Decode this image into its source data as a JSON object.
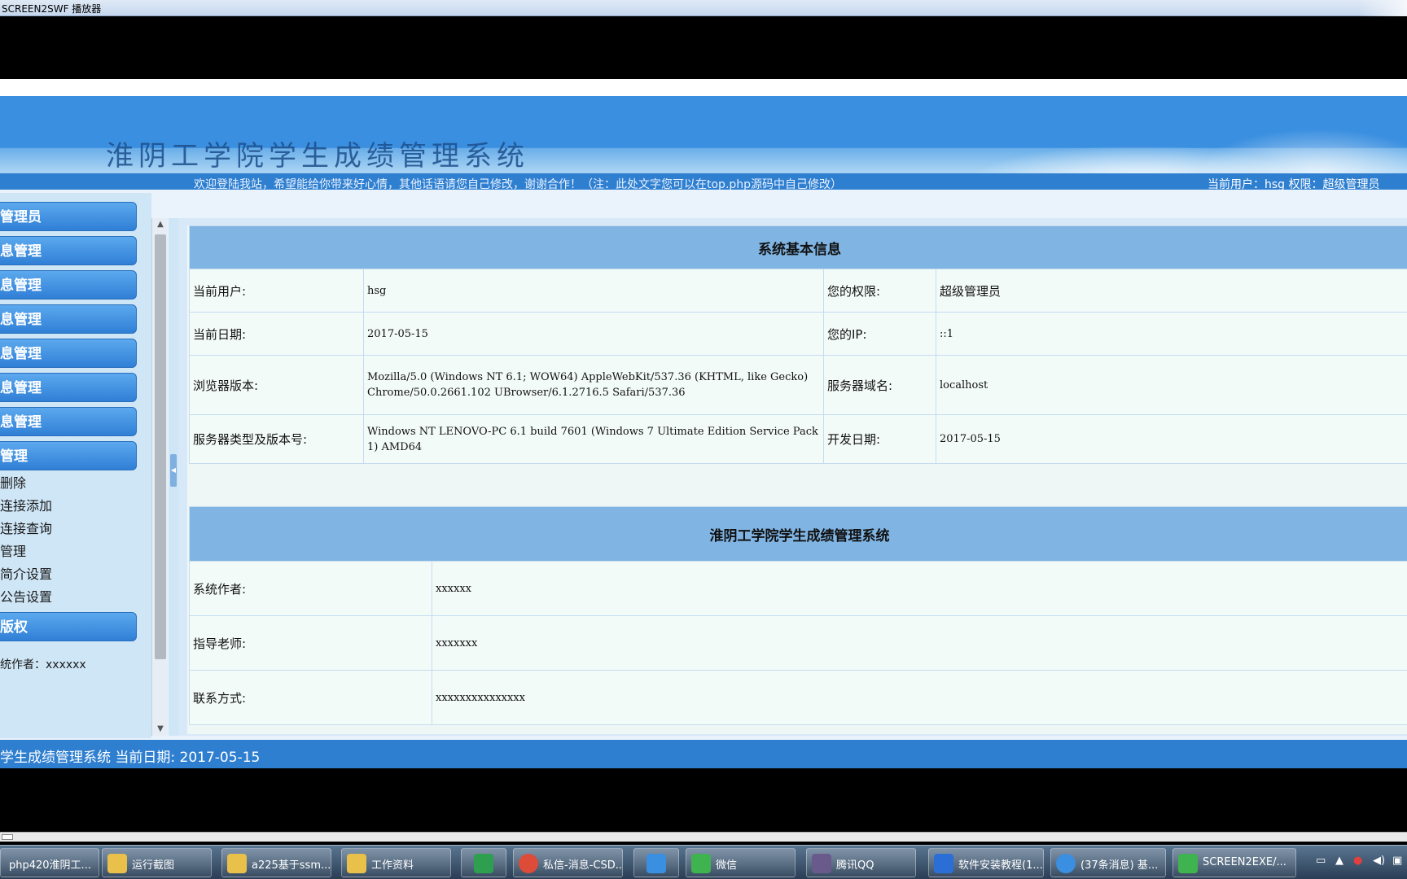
{
  "player": {
    "title": "SCREEN2SWF 播放器"
  },
  "header": {
    "site_title": "淮阴工学院学生成绩管理系统",
    "welcome": "欢迎登陆我站，希望能给你带来好心情，其他话语请您自己修改，谢谢合作！（注：此处文字您可以在top.php源码中自己修改）",
    "userinfo": "当前用户：hsg 权限：超级管理员"
  },
  "menu": {
    "heads": [
      "管理员",
      "息管理",
      "息管理",
      "息管理",
      "息管理",
      "息管理",
      "息管理",
      "管理"
    ],
    "subs": [
      "删除",
      "连接添加",
      "连接查询",
      "管理",
      "简介设置",
      "公告设置"
    ],
    "copyright_head": "版权",
    "footer": "统作者：xxxxxx"
  },
  "sysinfo": {
    "title": "系统基本信息",
    "rows": [
      {
        "label1": "当前用户:",
        "value1": "hsg",
        "label2": "您的权限:",
        "value2": "超级管理员"
      },
      {
        "label1": "当前日期:",
        "value1": "2017-05-15",
        "label2": "您的IP:",
        "value2": "::1"
      },
      {
        "label1": "浏览器版本:",
        "value1": "Mozilla/5.0 (Windows NT 6.1; WOW64) AppleWebKit/537.36 (KHTML, like Gecko) Chrome/50.0.2661.102 UBrowser/6.1.2716.5 Safari/537.36",
        "label2": "服务器域名:",
        "value2": "localhost"
      },
      {
        "label1": "服务器类型及版本号:",
        "value1": "Windows NT LENOVO-PC 6.1 build 7601 (Windows 7 Ultimate Edition Service Pack 1) AMD64",
        "label2": "开发日期:",
        "value2": "2017-05-15"
      }
    ]
  },
  "about": {
    "title": "淮阴工学院学生成绩管理系统",
    "rows": [
      {
        "label": "系统作者:",
        "value": "xxxxxx"
      },
      {
        "label": "指导老师:",
        "value": "xxxxxxx"
      },
      {
        "label": "联系方式:",
        "value": "xxxxxxxxxxxxxxx"
      }
    ]
  },
  "status_bar": "学生成绩管理系统 当前日期: 2017-05-15",
  "taskbar": {
    "tasks": [
      {
        "label": "php420淮阴工...",
        "color": "#1f3a58"
      },
      {
        "label": "运行截图",
        "color": "#e8c04a"
      },
      {
        "label": "a225基于ssm...",
        "color": "#e8c04a"
      },
      {
        "label": "工作资料",
        "color": "#e8c04a"
      },
      {
        "label": "",
        "color": "#2e9e4f"
      },
      {
        "label": "私信-消息-CSD...",
        "color": "#dd4b39"
      },
      {
        "label": "",
        "color": "#3b8fe0"
      },
      {
        "label": "微信",
        "color": "#3fb34f"
      },
      {
        "label": "腾讯QQ",
        "color": "#6a5a8c"
      },
      {
        "label": "软件安装教程(1...",
        "color": "#2b6fd6"
      },
      {
        "label": "(37条消息) 基...",
        "color": "#3b8fe0"
      },
      {
        "label": "SCREEN2EXE/...",
        "color": "#3fb34f"
      }
    ]
  }
}
